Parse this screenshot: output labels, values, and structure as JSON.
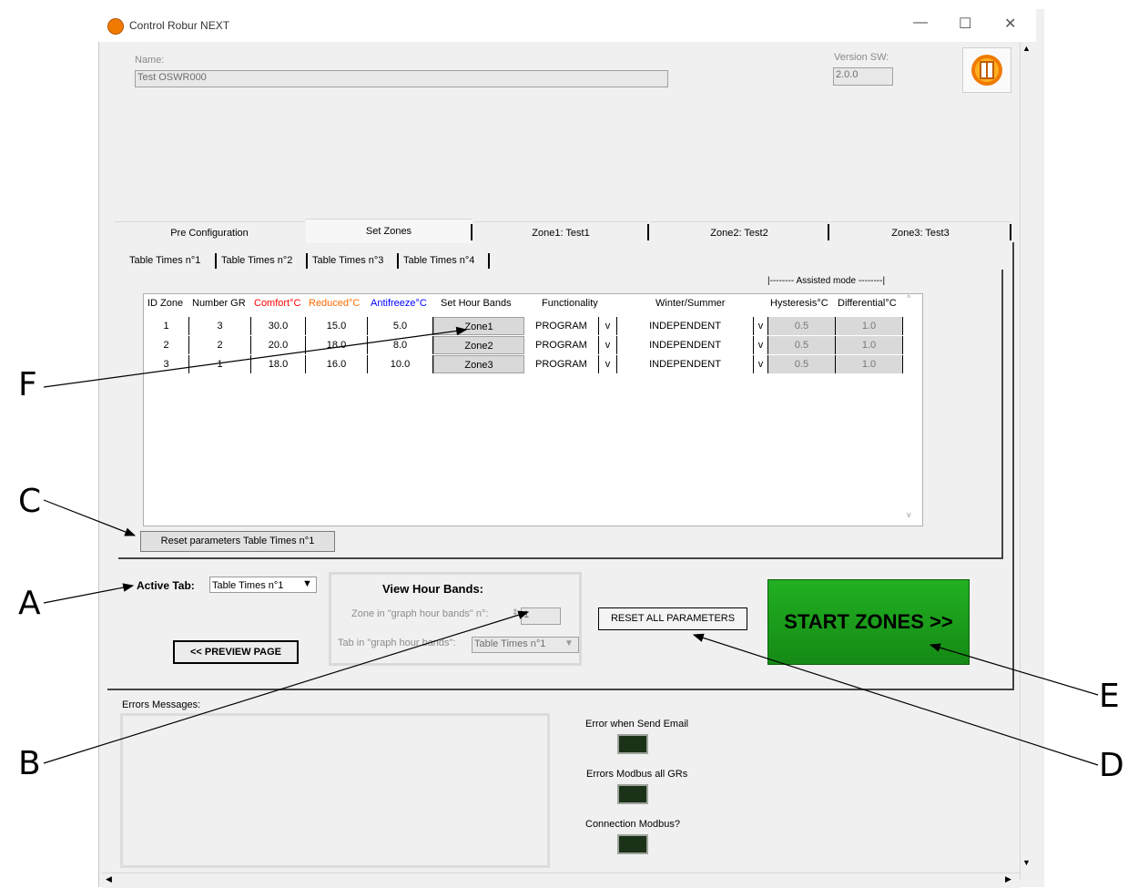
{
  "window": {
    "title": "Control Robur NEXT",
    "minimize": "—",
    "maximize": "☐",
    "close": "✕"
  },
  "header": {
    "name_label": "Name:",
    "name_value": "Test OSWR000",
    "version_label": "Version SW:",
    "version_value": "2.0.0"
  },
  "main_tabs": [
    "Pre Configuration",
    "Set Zones",
    "Zone1: Test1",
    "Zone2: Test2",
    "Zone3: Test3"
  ],
  "sub_tabs": [
    "Table Times n°1",
    "Table Times n°2",
    "Table Times n°3",
    "Table Times n°4"
  ],
  "table": {
    "assisted_header": "|-------- Assisted mode --------|",
    "columns": [
      "ID Zone",
      "Number GR",
      "Comfort°C",
      "Reduced°C",
      "Antifreeze°C",
      "Set Hour Bands",
      "Functionality",
      "Winter/Summer",
      "Hysteresis°C",
      "Differential°C"
    ],
    "rows": [
      {
        "id": "1",
        "gr": "3",
        "comfort": "30.0",
        "reduced": "15.0",
        "antifreeze": "5.0",
        "bands": "Zone1",
        "func": "PROGRAM",
        "ws": "INDEPENDENT",
        "hyst": "0.5",
        "diff": "1.0"
      },
      {
        "id": "2",
        "gr": "2",
        "comfort": "20.0",
        "reduced": "18.0",
        "antifreeze": "8.0",
        "bands": "Zone2",
        "func": "PROGRAM",
        "ws": "INDEPENDENT",
        "hyst": "0.5",
        "diff": "1.0"
      },
      {
        "id": "3",
        "gr": "1",
        "comfort": "18.0",
        "reduced": "16.0",
        "antifreeze": "10.0",
        "bands": "Zone3",
        "func": "PROGRAM",
        "ws": "INDEPENDENT",
        "hyst": "0.5",
        "diff": "1.0"
      }
    ]
  },
  "reset_table_button": "Reset parameters Table Times n°1",
  "active_tab": {
    "label": "Active Tab:",
    "value": "Table Times n°1"
  },
  "view_hour_bands": {
    "title": "View Hour Bands:",
    "zone_label": "Zone in \"graph hour bands\" n°:",
    "zone_value": "1",
    "tab_label": "Tab in \"graph hour bands\":",
    "tab_value": "Table Times n°1"
  },
  "preview_button": "<< PREVIEW PAGE",
  "reset_all_button": "RESET ALL PARAMETERS",
  "start_button": "START ZONES >>",
  "errors": {
    "label": "Errors Messages:",
    "email": "Error when Send Email",
    "modbus_all": "Errors Modbus all GRs",
    "connection": "Connection Modbus?"
  },
  "annotations": [
    "F",
    "C",
    "A",
    "B",
    "E",
    "D"
  ],
  "colors": {
    "comfort": "#ff0000",
    "reduced": "#ff6a00",
    "antifreeze": "#0000ff",
    "start_green": "#1a9a1a",
    "led_off": "#1b3118"
  }
}
